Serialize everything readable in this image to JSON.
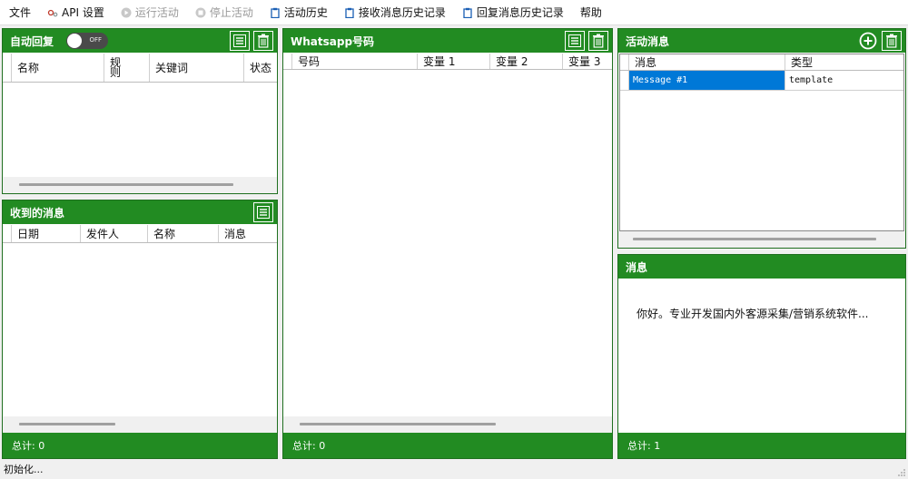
{
  "menu": {
    "file": "文件",
    "api_settings": "API 设置",
    "run_campaign": "运行活动",
    "stop_campaign": "停止活动",
    "campaign_history": "活动历史",
    "received_history": "接收消息历史记录",
    "reply_history": "回复消息历史记录",
    "help": "帮助"
  },
  "auto_reply": {
    "title": "自动回复",
    "toggle_text": "OFF",
    "columns": [
      "名称",
      "规则",
      "关键词",
      "状态"
    ]
  },
  "received": {
    "title": "收到的消息",
    "columns": [
      "日期",
      "发件人",
      "名称",
      "消息"
    ],
    "footer": "总计: 0"
  },
  "whatsapp": {
    "title": "Whatsapp号码",
    "columns": [
      "号码",
      "变量 1",
      "变量 2",
      "变量 3"
    ],
    "footer": "总计: 0"
  },
  "campaign": {
    "title": "活动消息",
    "columns": [
      "消息",
      "类型"
    ],
    "rows": [
      {
        "message": "Message #1",
        "type": "template"
      }
    ]
  },
  "message": {
    "title": "消息",
    "body": "你好。专业开发国内外客源采集/营销系统软件...",
    "footer": "总计: 1"
  },
  "status": {
    "text": "初始化..."
  },
  "colors": {
    "header_green": "#228b22",
    "selected_blue": "#0078d7"
  }
}
